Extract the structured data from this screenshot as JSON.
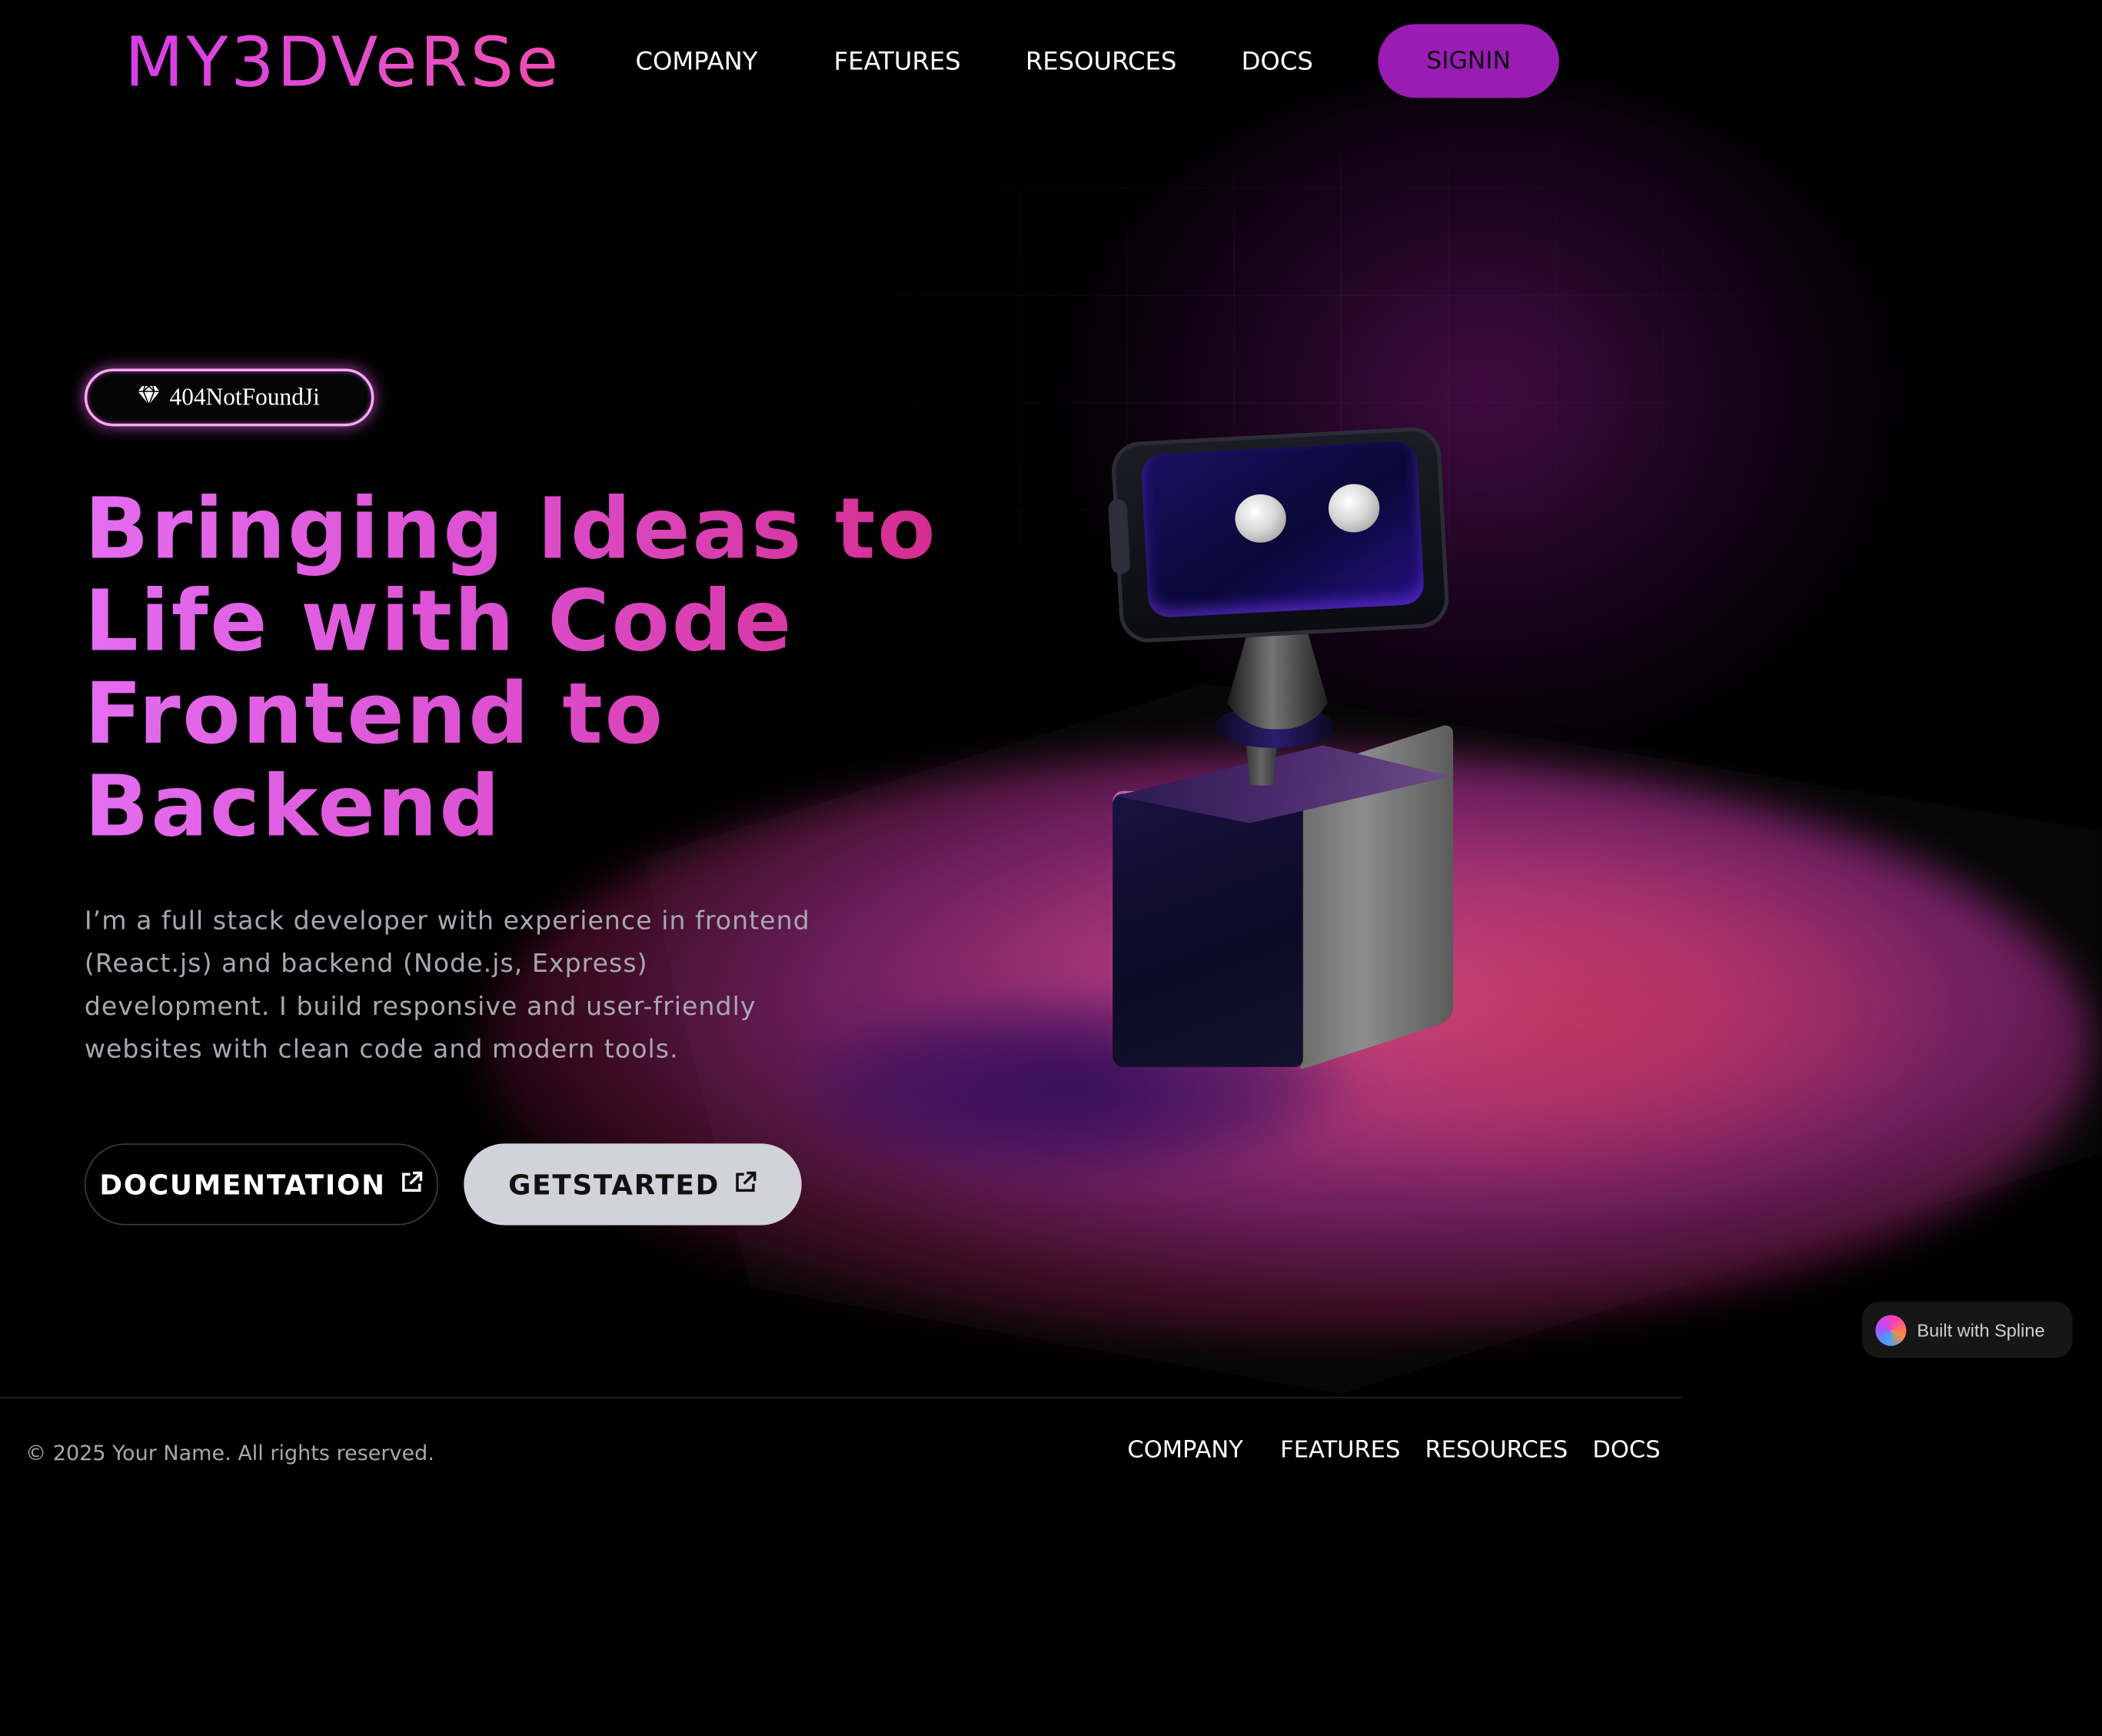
{
  "brand": {
    "logo_text": "MY3DVeRSe"
  },
  "nav": {
    "items": [
      "COMPANY",
      "FEATURES",
      "RESOURCES",
      "DOCS"
    ],
    "signin_label": "SIGNIN"
  },
  "hero": {
    "badge_label": "404NotFoundJi",
    "headline": "Bringing Ideas to Life with Code Frontend to Backend",
    "description": "I’m a full stack developer with experience in frontend (React.js) and backend (Node.js, Express) development. I build responsive and user-friendly websites with clean code and modern tools.",
    "buttons": {
      "documentation": "DOCUMENTATION",
      "get_started": "GETSTARTED"
    }
  },
  "spline_badge": {
    "label": "Built with Spline"
  },
  "footer": {
    "copyright": "© 2025 Your Name. All rights reserved.",
    "links": [
      "COMPANY",
      "FEATURES",
      "RESOURCES",
      "DOCS"
    ]
  },
  "colors": {
    "background": "#000000",
    "accent_purple": "#9b1bb5",
    "headline_pink": "#dc52d3",
    "muted_text": "#a7a7b1",
    "get_started_bg": "#d2d3da"
  },
  "icons": {
    "badge_icon": "gem-icon",
    "button_icon": "external-link-icon",
    "spline_icon": "spline-orb-icon"
  }
}
